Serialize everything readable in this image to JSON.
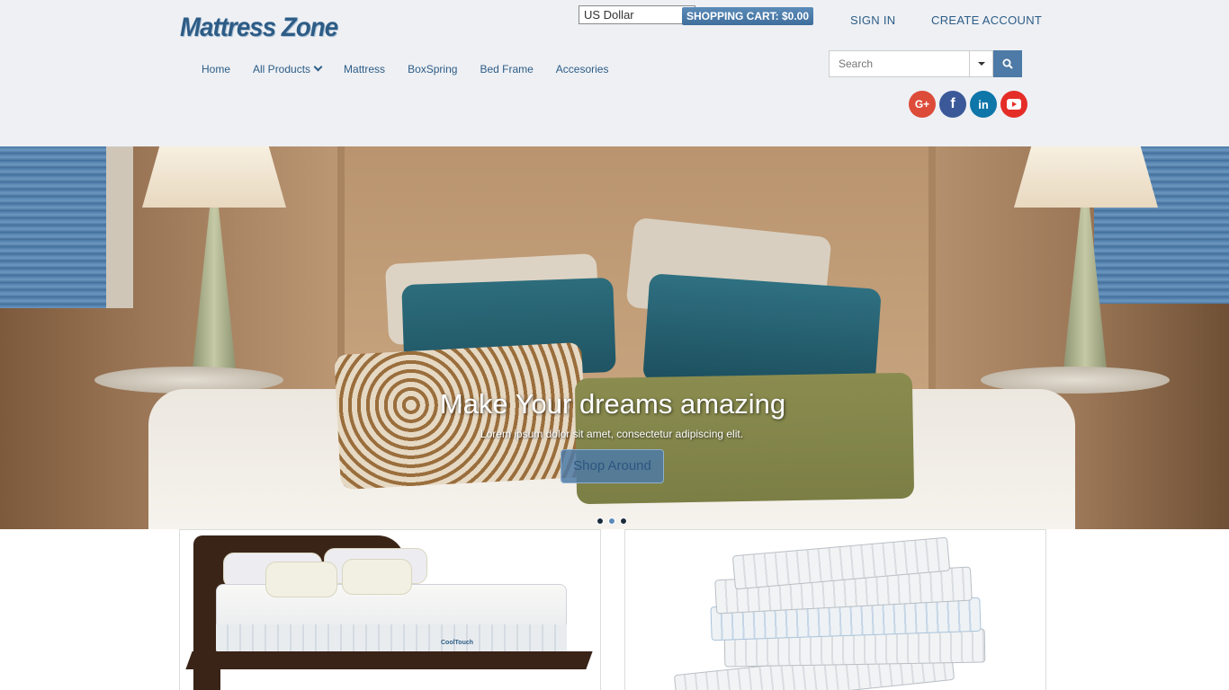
{
  "header": {
    "logo": "Mattress Zone",
    "currency": {
      "selected": "US Dollar"
    },
    "cart_label": "SHOPPING CART: $0.00",
    "signin": "SIGN IN",
    "create_account": "CREATE ACCOUNT",
    "nav": [
      "Home",
      "All Products",
      "Mattress",
      "BoxSpring",
      "Bed Frame",
      "Accesories"
    ],
    "search": {
      "placeholder": "Search"
    },
    "social": {
      "google": "G+",
      "facebook": "f",
      "linkedin": "in",
      "youtube": "youtube-icon"
    }
  },
  "hero": {
    "title": "Make Your dreams amazing",
    "subtitle": "Lorem ipsum dolor sit amet, consectetur adipiscing elit.",
    "button": "Shop Around",
    "slides": 3,
    "active_slide": 2
  },
  "products": {
    "card1_brand": "CoolTouch"
  },
  "colors": {
    "brand": "#2d5c86",
    "accent": "#4d7aa6",
    "google": "#dd4b39",
    "facebook": "#3b5998",
    "linkedin": "#0e76a8",
    "youtube": "#e52d27"
  }
}
